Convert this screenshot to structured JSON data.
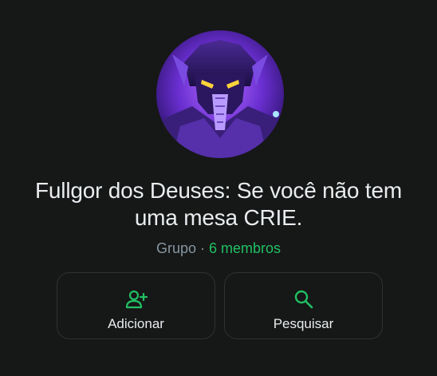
{
  "group": {
    "name": "Fullgor dos Deuses: Se você não tem uma mesa CRIE.",
    "type_label": "Grupo",
    "separator": " · ",
    "members_label": "6 membros"
  },
  "actions": [
    {
      "label": "Adicionar",
      "icon": "add-person-icon"
    },
    {
      "label": "Pesquisar",
      "icon": "search-icon"
    }
  ],
  "colors": {
    "background": "#161717",
    "accent": "#21c063",
    "text": "#e9edef",
    "muted": "#8696a0",
    "border": "#2f3133"
  }
}
